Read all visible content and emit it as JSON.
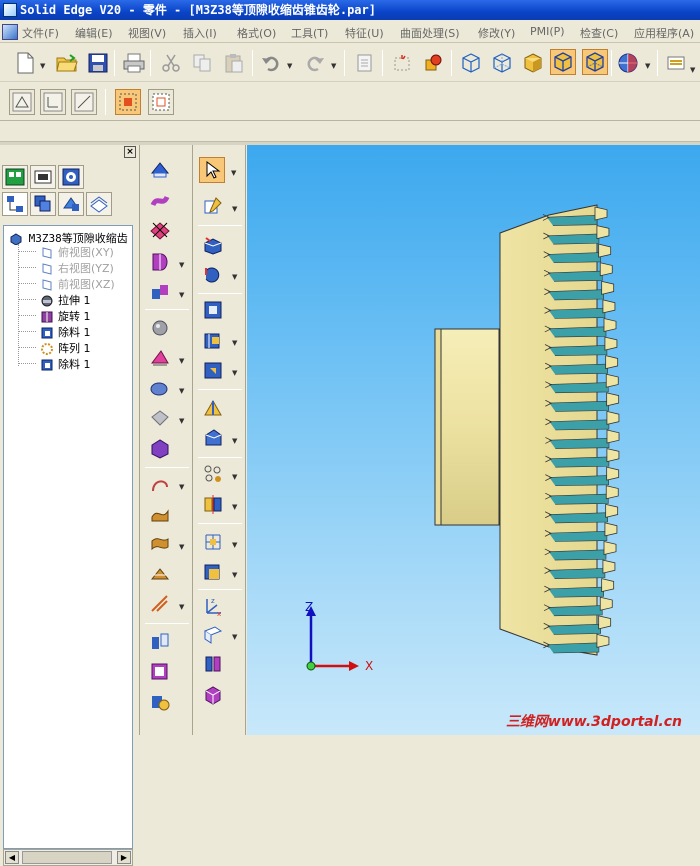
{
  "window": {
    "title": "Solid Edge V20 - 零件 - [M3Z38等顶隙收缩齿锥齿轮.par]"
  },
  "menu": {
    "items": [
      "文件(F)",
      "编辑(E)",
      "视图(V)",
      "插入(I)",
      "格式(O)",
      "工具(T)",
      "特征(U)",
      "曲面处理(S)",
      "修改(Y)",
      "PMI(P)",
      "检查(C)",
      "应用程序(A)"
    ]
  },
  "toolbar": {
    "buttons": [
      "new-icon",
      "open-icon",
      "save-icon",
      "print-icon",
      "cut-icon",
      "copy-icon",
      "paste-icon",
      "undo-icon",
      "redo-icon",
      "doc-icon",
      "sketch-icon",
      "part-icon",
      "view-iso-icon",
      "view-wire-icon",
      "shade-icon",
      "shade-edges-icon",
      "shade-active-icon",
      "sphere-view-icon",
      "layer-icon"
    ],
    "colors": {
      "active": "#f8c878",
      "shaded": "#f0c040",
      "wire": "#2060c0"
    }
  },
  "feature_tree": {
    "root": "M3Z38等顶隙收缩齿",
    "items": [
      {
        "label": "俯视图(XY)",
        "kind": "reference-plane"
      },
      {
        "label": "右视图(YZ)",
        "kind": "reference-plane"
      },
      {
        "label": "前视图(XZ)",
        "kind": "reference-plane"
      },
      {
        "label": "拉伸 1",
        "kind": "protrusion"
      },
      {
        "label": "旋转 1",
        "kind": "revolve"
      },
      {
        "label": "除料 1",
        "kind": "cutout"
      },
      {
        "label": "阵列 1",
        "kind": "pattern"
      },
      {
        "label": "除料 1",
        "kind": "cutout"
      }
    ]
  },
  "viewport": {
    "background_top": "#3ca8ee",
    "background_bottom": "#c8e8fa",
    "model_color": "#efe5a2",
    "tooth_cut_color": "#3ca0a8",
    "axes": {
      "z_label": "Z",
      "x_label": "X",
      "z_color": "#1010c0",
      "x_color": "#d01010"
    },
    "watermark": "三维网www.3dportal.cn"
  }
}
